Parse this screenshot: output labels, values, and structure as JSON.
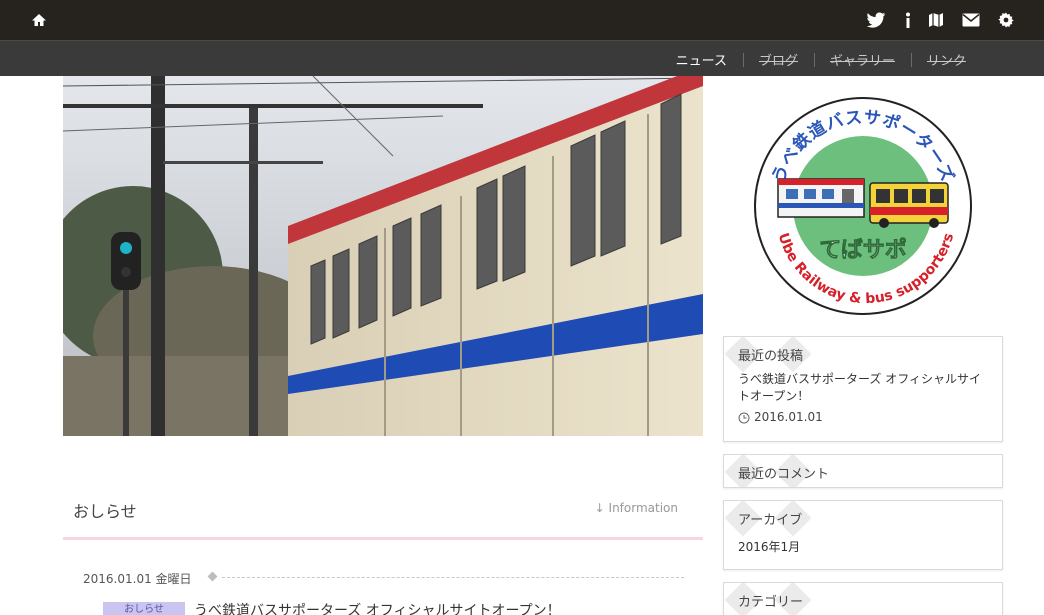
{
  "nav": {
    "top_icons": [
      "home-icon",
      "twitter-icon",
      "info-icon",
      "map-icon",
      "mail-icon",
      "gear-icon"
    ],
    "menu": [
      {
        "label": "ニュース"
      },
      {
        "label": "ブログ"
      },
      {
        "label": "ギャラリー"
      },
      {
        "label": "リンク"
      }
    ]
  },
  "news": {
    "title": "おしらせ",
    "link": "↓ Information",
    "post": {
      "date": "2016.01.01 金曜日",
      "tag": "おしらせ",
      "title": "うべ鉄道バスサポーターズ オフィシャルサイトオープン！"
    }
  },
  "logo": {
    "top_text": "うべ鉄道バスサポーターズ",
    "main_text": "てばサポ",
    "bottom_text": "Ube Railway & bus supporters"
  },
  "sidebar": {
    "recent_posts": {
      "title": "最近の投稿",
      "post_title": "うべ鉄道バスサポーターズ オフィシャルサイトオープン！",
      "post_date": "2016.01.01"
    },
    "recent_comments": {
      "title": "最近のコメント"
    },
    "archives": {
      "title": "アーカイブ",
      "item": "2016年1月"
    },
    "categories": {
      "title": "カテゴリー"
    }
  },
  "colors": {
    "topbar": "#26231f",
    "subnav": "#3a3a3a",
    "accent_pink": "#f6d6e4",
    "tag_bg": "#c9c4f0",
    "logo_green": "#6cbf7c",
    "logo_red": "#d6202a",
    "logo_blue": "#2a56b8"
  }
}
